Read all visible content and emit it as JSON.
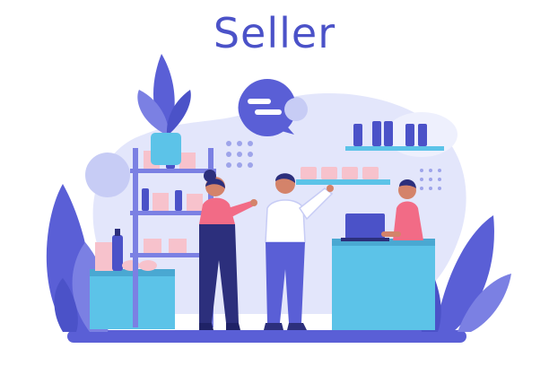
{
  "header": {
    "title": "Seller"
  },
  "colors": {
    "title": "#4b52c8",
    "primary_purple": "#5a5fd6",
    "light_lavender": "#e3e6fb",
    "mid_lavender": "#c7ccf5",
    "counter_blue": "#5cc3e8",
    "skin": "#d4836a",
    "pink_shirt": "#f26b86",
    "navy_pants": "#2c2f7c",
    "product_pink": "#f7c2cc"
  },
  "scene": {
    "icons": [
      "plant-icon",
      "speech-bubble-icon",
      "laptop-icon",
      "shelf-icon",
      "counter-icon",
      "product-bottle-icon"
    ]
  }
}
